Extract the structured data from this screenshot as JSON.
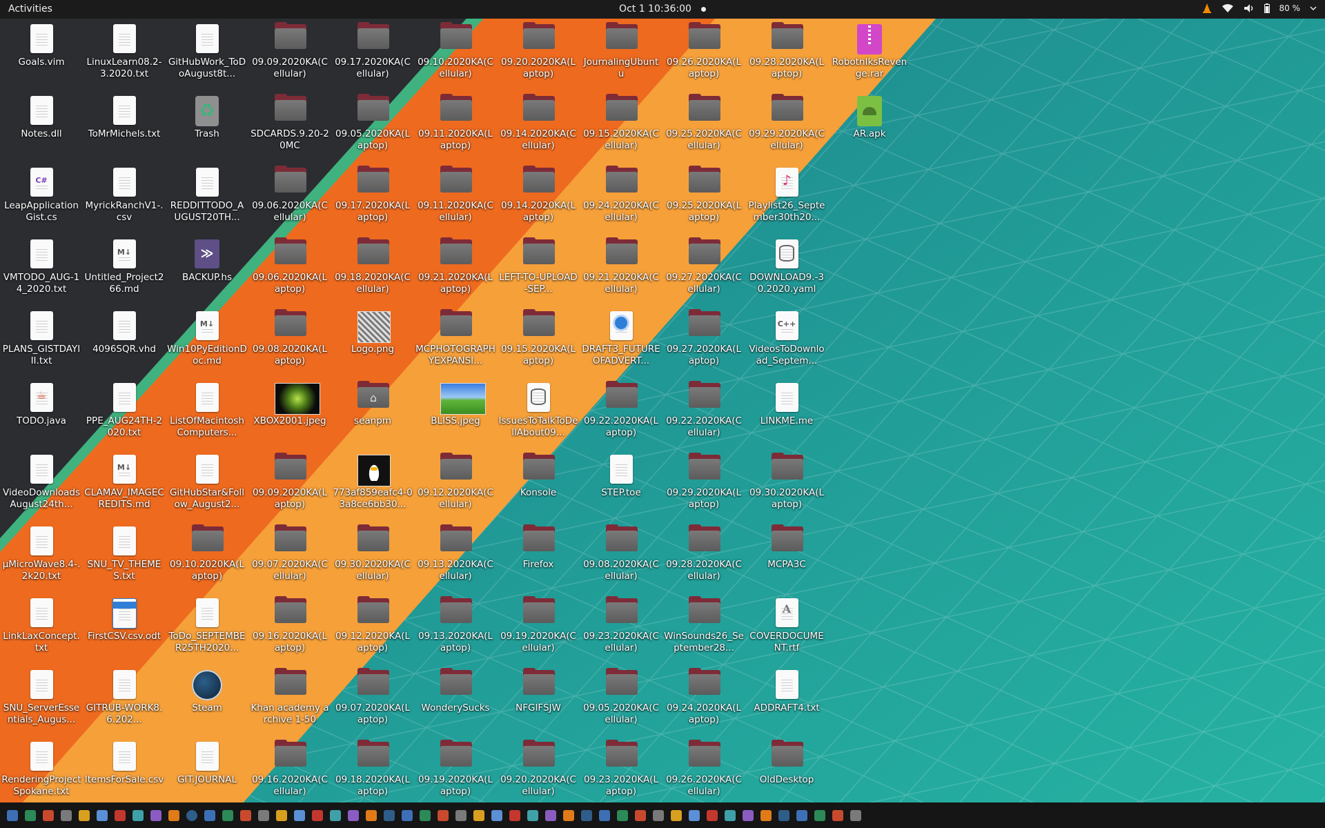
{
  "topbar": {
    "activities": "Activities",
    "clock": "Oct 1  10:36:00",
    "battery": "80 %"
  },
  "desktop": {
    "columns": [
      [
        {
          "label": "Goals.vim",
          "icon": "text-file-icon"
        },
        {
          "label": "Notes.dll",
          "icon": "text-file-icon"
        },
        {
          "label": "LeapApplicationGist.cs",
          "icon": "csharp-file-icon",
          "tag": "C#"
        },
        {
          "label": "VMTODO_AUG-14_2020.txt",
          "icon": "text-file-icon"
        },
        {
          "label": "PLANS_GISTDAYIII.txt",
          "icon": "text-file-icon"
        },
        {
          "label": "TODO.java",
          "icon": "java-file-icon"
        },
        {
          "label": "VideoDownloadsAugust24th...",
          "icon": "text-file-icon"
        },
        {
          "label": "µMicroWave8.4-.2k20.txt",
          "icon": "text-file-icon"
        },
        {
          "label": "LinkLaxConcept.txt",
          "icon": "text-file-icon"
        },
        {
          "label": "SNU_ServerEssentials_Augus...",
          "icon": "text-file-icon"
        },
        {
          "label": "RenderingProjectSpokane.txt",
          "icon": "text-file-icon"
        }
      ],
      [
        {
          "label": "LinuxLearn08.2-3.2020.txt",
          "icon": "text-file-icon"
        },
        {
          "label": "ToMrMichels.txt",
          "icon": "text-file-icon"
        },
        {
          "label": "MyrickRanchV1-.csv",
          "icon": "text-file-icon"
        },
        {
          "label": "Untitled_Project266.md",
          "icon": "markdown-file-icon",
          "tag": "M↓"
        },
        {
          "label": "4096SQR.vhd",
          "icon": "text-file-icon"
        },
        {
          "label": "PPE_AUG24TH-2020.txt",
          "icon": "text-file-icon"
        },
        {
          "label": "CLAMAV_IMAGECREDITS.md",
          "icon": "markdown-file-icon",
          "tag": "M↓"
        },
        {
          "label": "SNU_TV_THEMES.txt",
          "icon": "text-file-icon"
        },
        {
          "label": "FirstCSV.csv.odt",
          "icon": "document-file-icon"
        },
        {
          "label": "GITRUB-WORK8.6.202...",
          "icon": "text-file-icon"
        },
        {
          "label": "ItemsForSale.csv",
          "icon": "text-file-icon"
        }
      ],
      [
        {
          "label": "GitHubWork_ToDoAugust8t...",
          "icon": "text-file-icon"
        },
        {
          "label": "Trash",
          "icon": "trash-icon"
        },
        {
          "label": "REDDITTODO_AUGUST20TH...",
          "icon": "text-file-icon"
        },
        {
          "label": "BACKUP.hs",
          "icon": "haskell-file-icon"
        },
        {
          "label": "Win10PyEditionDoc.md",
          "icon": "markdown-file-icon",
          "tag": "M↓"
        },
        {
          "label": "ListOfMacintoshComputers...",
          "icon": "text-file-icon"
        },
        {
          "label": "GitHubStar&Follow_August2...",
          "icon": "text-file-icon"
        },
        {
          "label": "09.10.2020KA(Laptop)",
          "icon": "folder-icon"
        },
        {
          "label": "ToDo_SEPTEMBER25TH2020...",
          "icon": "text-file-icon"
        },
        {
          "label": "Steam",
          "icon": "steam-icon"
        },
        {
          "label": "GIT.JOURNAL",
          "icon": "text-file-icon"
        }
      ],
      [
        {
          "label": "09.09.2020KA(Cellular)",
          "icon": "folder-icon"
        },
        {
          "label": "SDCARDS.9.20-20MC",
          "icon": "folder-icon"
        },
        {
          "label": "09.06.2020KA(Cellular)",
          "icon": "folder-icon"
        },
        {
          "label": "09.06.2020KA(Laptop)",
          "icon": "folder-icon"
        },
        {
          "label": "09.08.2020KA(Laptop)",
          "icon": "folder-icon"
        },
        {
          "label": "XBOX2001.jpeg",
          "icon": "xbox-image-icon"
        },
        {
          "label": "09.09.2020KA(Laptop)",
          "icon": "folder-icon"
        },
        {
          "label": "09.07.2020KA(Cellular)",
          "icon": "folder-icon"
        },
        {
          "label": "09.16.2020KA(Laptop)",
          "icon": "folder-icon"
        },
        {
          "label": "Khan academy archive 1-50",
          "icon": "folder-icon"
        },
        {
          "label": "09.16.2020KA(Cellular)",
          "icon": "folder-icon"
        }
      ],
      [
        {
          "label": "09.17.2020KA(Cellular)",
          "icon": "folder-icon"
        },
        {
          "label": "09.05.2020KA(Laptop)",
          "icon": "folder-icon"
        },
        {
          "label": "09.17.2020KA(Laptop)",
          "icon": "folder-icon"
        },
        {
          "label": "09.18.2020KA(Cellular)",
          "icon": "folder-icon"
        },
        {
          "label": "Logo.png",
          "icon": "logo-image-icon"
        },
        {
          "label": "seanpm",
          "icon": "home-folder-icon"
        },
        {
          "label": "773af859eafc4-03a8ce6bb30...",
          "icon": "tux-image-icon"
        },
        {
          "label": "09.30.2020KA(Cellular)",
          "icon": "folder-icon"
        },
        {
          "label": "09.12.2020KA(Laptop)",
          "icon": "folder-icon"
        },
        {
          "label": "09.07.2020KA(Laptop)",
          "icon": "folder-icon"
        },
        {
          "label": "09.18.2020KA(Laptop)",
          "icon": "folder-icon"
        }
      ],
      [
        {
          "label": "09.10.2020KA(Cellular)",
          "icon": "folder-icon"
        },
        {
          "label": "09.11.2020KA(Laptop)",
          "icon": "folder-icon"
        },
        {
          "label": "09.11.2020KA(Cellular)",
          "icon": "folder-icon"
        },
        {
          "label": "09.21.2020KA(Laptop)",
          "icon": "folder-icon"
        },
        {
          "label": "MCPHOTOGRAPHYEXPANSI...",
          "icon": "folder-icon"
        },
        {
          "label": "BLISS.jpeg",
          "icon": "bliss-image-icon"
        },
        {
          "label": "09.12.2020KA(Cellular)",
          "icon": "folder-icon"
        },
        {
          "label": "09.13.2020KA(Cellular)",
          "icon": "folder-icon"
        },
        {
          "label": "09.13.2020KA(Laptop)",
          "icon": "folder-icon"
        },
        {
          "label": "WonderySucks",
          "icon": "folder-icon"
        },
        {
          "label": "09.19.2020KA(Laptop)",
          "icon": "folder-icon"
        }
      ],
      [
        {
          "label": "09.20.2020KA(Laptop)",
          "icon": "folder-icon"
        },
        {
          "label": "09.14.2020KA(Cellular)",
          "icon": "folder-icon"
        },
        {
          "label": "09.14.2020KA(Laptop)",
          "icon": "folder-icon"
        },
        {
          "label": "LEFT-TO-UPLOAD-SEP...",
          "icon": "folder-icon"
        },
        {
          "label": "09.15.2020KA(Laptop)",
          "icon": "folder-icon"
        },
        {
          "label": "IssuesToTalkToDellAbout09...",
          "icon": "database-file-icon"
        },
        {
          "label": "Konsole",
          "icon": "folder-icon"
        },
        {
          "label": "Firefox",
          "icon": "folder-icon"
        },
        {
          "label": "09.19.2020KA(Cellular)",
          "icon": "folder-icon"
        },
        {
          "label": "NFGIFSJW",
          "icon": "folder-icon"
        },
        {
          "label": "09.20.2020KA(Cellular)",
          "icon": "folder-icon"
        }
      ],
      [
        {
          "label": "JournalingUbuntu",
          "icon": "folder-icon"
        },
        {
          "label": "09.15.2020KA(Cellular)",
          "icon": "folder-icon"
        },
        {
          "label": "09.24.2020KA(Cellular)",
          "icon": "folder-icon"
        },
        {
          "label": "09.21.2020KA(Cellular)",
          "icon": "folder-icon"
        },
        {
          "label": "DRAFT3_FUTUREOFADVERT...",
          "icon": "drawing-file-icon"
        },
        {
          "label": "09.22.2020KA(Laptop)",
          "icon": "folder-icon"
        },
        {
          "label": "STEP.toe",
          "icon": "text-file-icon"
        },
        {
          "label": "09.08.2020KA(Cellular)",
          "icon": "folder-icon"
        },
        {
          "label": "09.23.2020KA(Cellular)",
          "icon": "folder-icon"
        },
        {
          "label": "09.05.2020KA(Cellular)",
          "icon": "folder-icon"
        },
        {
          "label": "09.23.2020KA(Laptop)",
          "icon": "folder-icon"
        }
      ],
      [
        {
          "label": "09.26.2020KA(Laptop)",
          "icon": "folder-icon"
        },
        {
          "label": "09.25.2020KA(Cellular)",
          "icon": "folder-icon"
        },
        {
          "label": "09.25.2020KA(Laptop)",
          "icon": "folder-icon"
        },
        {
          "label": "09.27.2020KA(Cellular)",
          "icon": "folder-icon"
        },
        {
          "label": "09.27.2020KA(Laptop)",
          "icon": "folder-icon"
        },
        {
          "label": "09.22.2020KA(Cellular)",
          "icon": "folder-icon"
        },
        {
          "label": "09.29.2020KA(Laptop)",
          "icon": "folder-icon"
        },
        {
          "label": "09.28.2020KA(Cellular)",
          "icon": "folder-icon"
        },
        {
          "label": "WinSounds26_September28...",
          "icon": "folder-icon"
        },
        {
          "label": "09.24.2020KA(Laptop)",
          "icon": "folder-icon"
        },
        {
          "label": "09.26.2020KA(Cellular)",
          "icon": "folder-icon"
        }
      ],
      [
        {
          "label": "09.28.2020KA(Laptop)",
          "icon": "folder-icon"
        },
        {
          "label": "09.29.2020KA(Cellular)",
          "icon": "folder-icon"
        },
        {
          "label": "Playlist26_September30th20...",
          "icon": "playlist-file-icon"
        },
        {
          "label": "DOWNLOAD9.-30.2020.yaml",
          "icon": "yaml-file-icon"
        },
        {
          "label": "VideosToDownload_Septem...",
          "icon": "cpp-file-icon",
          "tag": "C++"
        },
        {
          "label": "LINKME.me",
          "icon": "text-file-icon"
        },
        {
          "label": "09.30.2020KA(Laptop)",
          "icon": "folder-icon"
        },
        {
          "label": "MCPA3C",
          "icon": "folder-icon"
        },
        {
          "label": "COVERDOCUMENT.rtf",
          "icon": "rtf-file-icon"
        },
        {
          "label": "ADDRAFT4.txt",
          "icon": "text-file-icon"
        },
        {
          "label": "OldDesktop",
          "icon": "folder-icon"
        }
      ],
      [
        {
          "label": "RobotnIksRevenge.rar",
          "icon": "archive-file-icon"
        },
        {
          "label": "AR.apk",
          "icon": "android-package-icon"
        }
      ]
    ]
  },
  "colors": {
    "topbar": "#1b1b1b",
    "wallpaper_dark": "#2b2d31",
    "wallpaper_orange": "#ee6a1f",
    "wallpaper_light_orange": "#f6a03a",
    "wallpaper_green": "#3fb27f",
    "wallpaper_teal": "#1f8f8f",
    "folder_front": "#6b6b6b",
    "folder_back": "#7e2b38"
  },
  "dock": {
    "icons": [
      "terminal-icon",
      "docs-icon",
      "calc-icon",
      "sheets-icon",
      "notes-icon",
      "edit-icon",
      "chart-icon",
      "tools-icon",
      "files-icon",
      "vlc-icon",
      "firefox-icon",
      "app-icon",
      "app-icon",
      "app-icon",
      "app-icon",
      "app-icon",
      "app-icon",
      "app-icon",
      "app-icon",
      "app-icon",
      "app-icon",
      "app-icon",
      "app-icon",
      "app-icon",
      "app-icon",
      "app-icon",
      "app-icon",
      "app-icon",
      "app-icon",
      "app-icon",
      "app-icon",
      "app-icon",
      "app-icon",
      "app-icon",
      "app-icon",
      "app-icon",
      "app-icon",
      "app-icon",
      "app-icon",
      "app-icon",
      "app-icon",
      "app-icon",
      "app-icon",
      "app-icon",
      "app-icon",
      "app-icon",
      "app-icon",
      "grid-icon"
    ]
  }
}
